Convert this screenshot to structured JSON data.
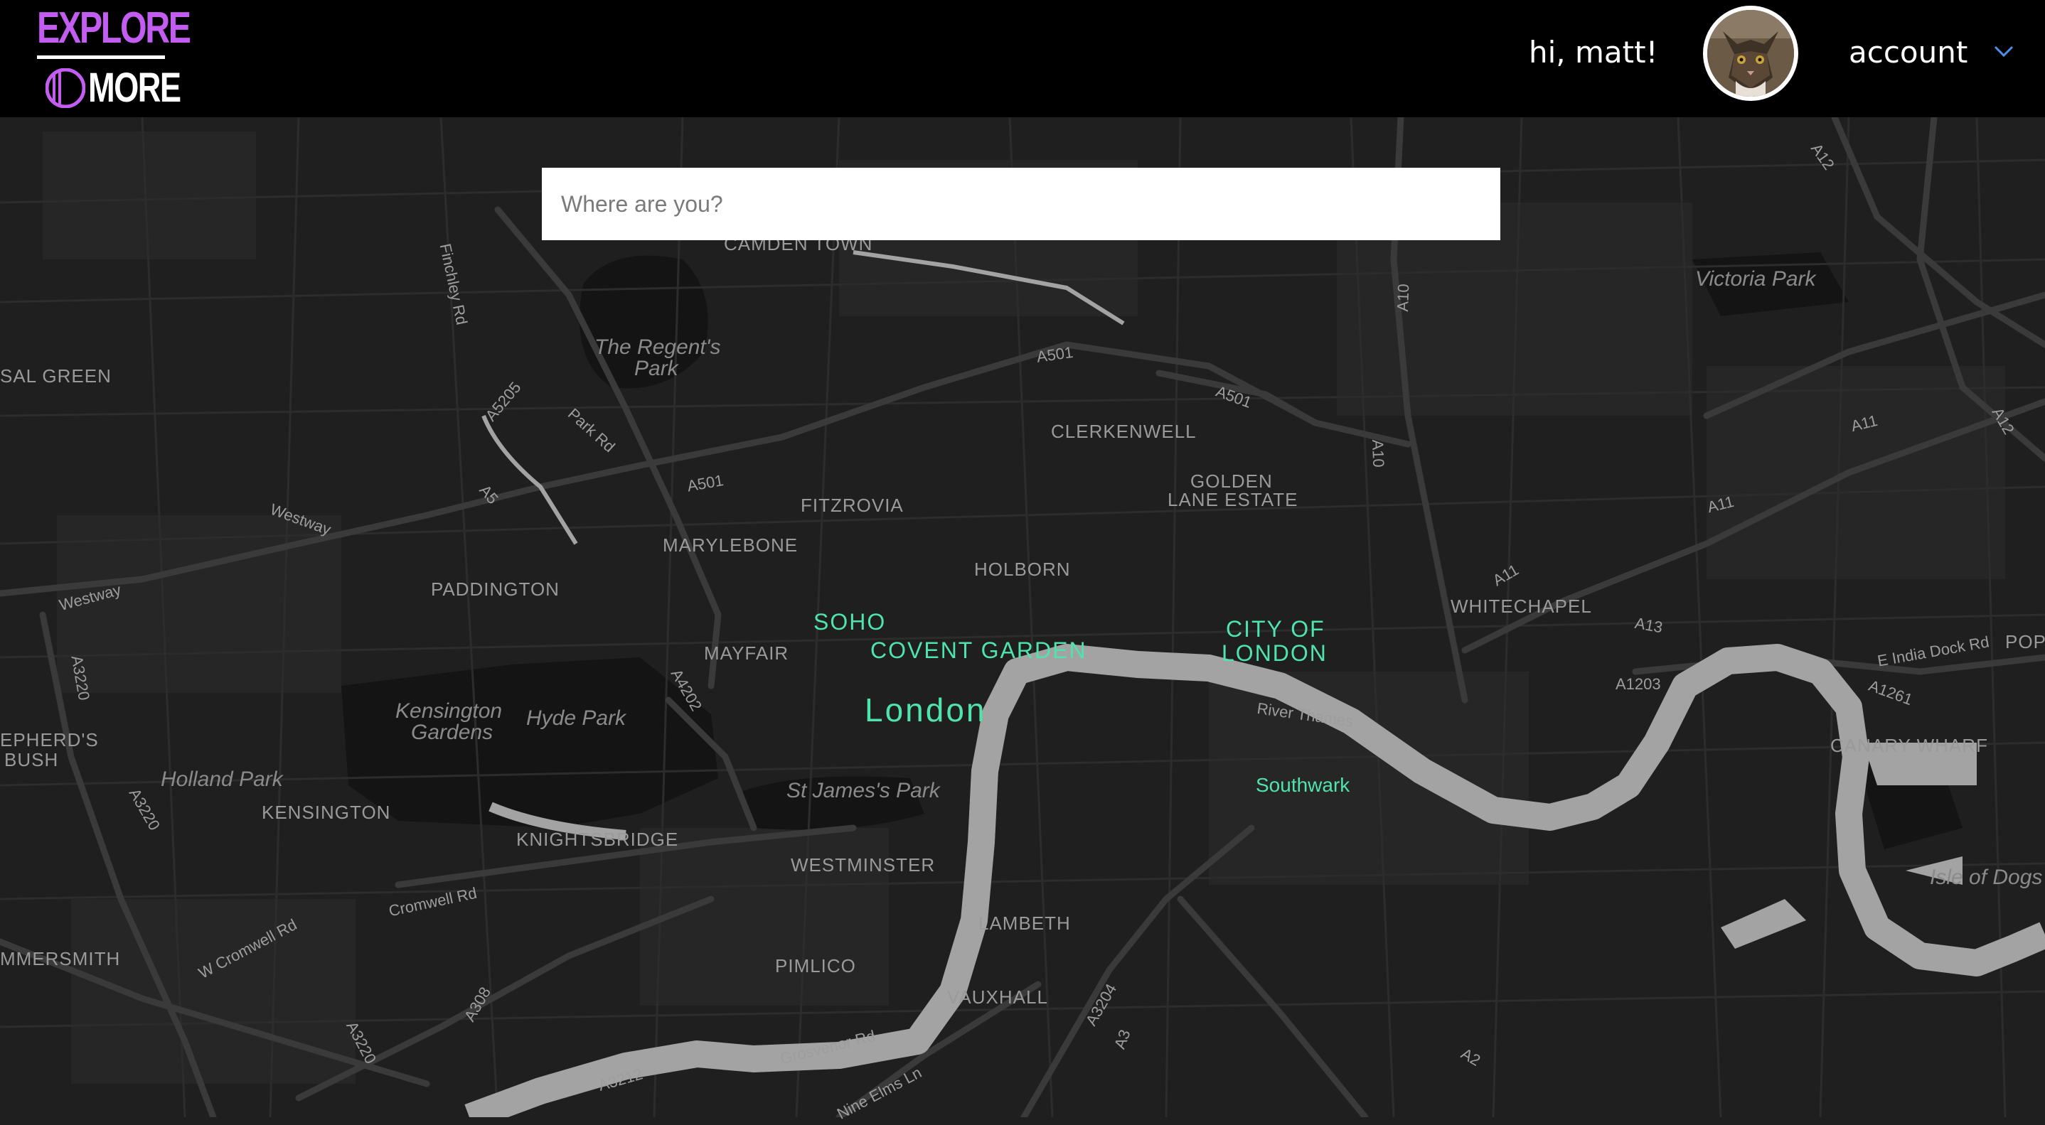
{
  "header": {
    "logo_top": "EXPLORE",
    "logo_bottom": "MORE",
    "greeting": "hi, matt!",
    "account_label": "account",
    "avatar_icon": "cat-avatar-icon"
  },
  "colors": {
    "brand_purple": "#c35cf0",
    "map_background": "#1f1f1f",
    "river": "#a3a3a3",
    "district_highlight": "#4fe3ad",
    "header_background": "#000000"
  },
  "search": {
    "placeholder": "Where are you?",
    "value": ""
  },
  "map": {
    "districts": {
      "camden_town": "CAMDEN TOWN",
      "clerkenwell": "CLERKENWELL",
      "golden_lane_1": "GOLDEN",
      "golden_lane_2": "LANE ESTATE",
      "fitzrovia": "FITZROVIA",
      "marylebone": "MARYLEBONE",
      "holborn": "HOLBORN",
      "paddington": "PADDINGTON",
      "whitechapel": "WHITECHAPEL",
      "mayfair": "MAYFAIR",
      "kensington": "KENSINGTON",
      "knightsbridge": "KNIGHTSBRIDGE",
      "westminster": "WESTMINSTER",
      "lambeth": "LAMBETH",
      "pimlico": "PIMLICO",
      "vauxhall": "VAUXHALL",
      "canary_wharf": "CANARY WHARF",
      "kensal_green": "SAL GREEN",
      "shepherds_bush_1": "EPHERD'S",
      "shepherds_bush_2": "BUSH",
      "hammersmith": "MMERSMITH",
      "poplar": "POPL"
    },
    "highlighted": {
      "soho": "SOHO",
      "covent_garden": "COVENT GARDEN",
      "london": "London",
      "city_1": "CITY OF",
      "city_2": "LONDON",
      "southwark": "Southwark"
    },
    "parks": {
      "regents_1": "The Regent's",
      "regents_2": "Park",
      "victoria": "Victoria Park",
      "kensington_gardens_1": "Kensington",
      "kensington_gardens_2": "Gardens",
      "hyde": "Hyde Park",
      "holland": "Holland Park",
      "st_james": "St James's Park",
      "isle_of_dogs": "Isle of Dogs"
    },
    "roads": {
      "finchley": "Finchley Rd",
      "a5205": "A5205",
      "park_rd": "Park Rd",
      "a5": "A5",
      "a501_a": "A501",
      "a501_b": "A501",
      "a501_c": "A501",
      "a10_a": "A10",
      "a10_b": "A10",
      "westway_a": "Westway",
      "westway_b": "Westway",
      "a3220_a": "A3220",
      "a3220_b": "A3220",
      "a3220_c": "A3220",
      "a4202": "A4202",
      "cromwell": "Cromwell Rd",
      "w_cromwell": "W Cromwell Rd",
      "a308": "A308",
      "a3212": "A3212",
      "grosvenor": "Grosvenor Rd",
      "nine_elms": "Nine Elms Ln",
      "a3204": "A3204",
      "a3": "A3",
      "a2": "A2",
      "a11_a": "A11",
      "a11_b": "A11",
      "a11_c": "A11",
      "a13": "A13",
      "a1203": "A1203",
      "a1261": "A1261",
      "e_india": "E India Dock Rd",
      "a12_a": "A12",
      "a12_b": "A12",
      "river_thames": "River Thames"
    }
  }
}
